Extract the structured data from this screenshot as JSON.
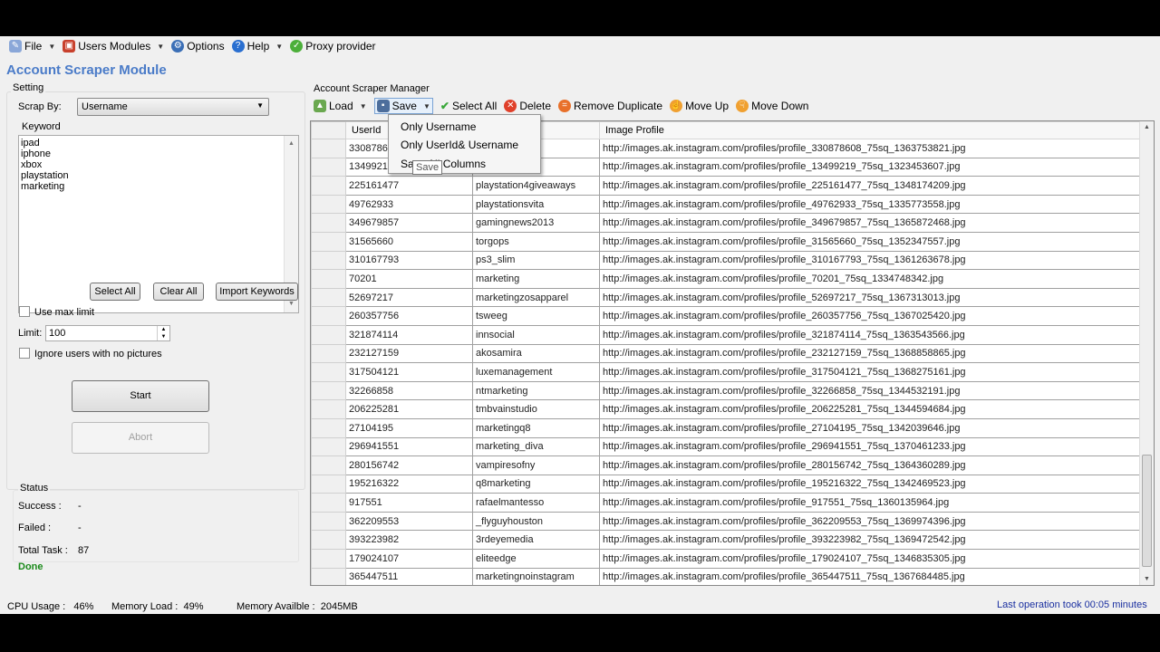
{
  "menu": [
    {
      "label": "File",
      "icon": "file-icon",
      "dropdown": true
    },
    {
      "label": "Users Modules",
      "icon": "users-modules-icon",
      "dropdown": true
    },
    {
      "label": "Options",
      "icon": "options-icon",
      "dropdown": false
    },
    {
      "label": "Help",
      "icon": "help-icon",
      "dropdown": true
    },
    {
      "label": "Proxy provider",
      "icon": "proxy-check-icon",
      "dropdown": false
    }
  ],
  "title": "Account Scraper Module",
  "setting": {
    "group": "Setting",
    "scrap_by_label": "Scrap By:",
    "scrap_by_value": "Username",
    "keyword_label": "Keyword",
    "keywords": [
      "ipad",
      "iphone",
      "xbox",
      "playstation",
      "marketing"
    ],
    "select_all": "Select All",
    "clear_all": "Clear All",
    "import_keywords": "Import Keywords",
    "use_max_limit": "Use max limit",
    "use_max_limit_checked": false,
    "limit_label": "Limit:",
    "limit_value": "100",
    "ignore_label": "Ignore users with no pictures",
    "ignore_checked": false,
    "start": "Start",
    "abort": "Abort"
  },
  "status": {
    "group": "Status",
    "success_label": "Success :",
    "success_value": "-",
    "failed_label": "Failed :",
    "failed_value": "-",
    "total_label": "Total Task :",
    "total_value": "87",
    "state": "Done",
    "state_color": "#1a8a1a"
  },
  "manager": {
    "group": "Account Scraper Manager",
    "toolbar": {
      "load": "Load",
      "save": "Save",
      "select_all": "Select All",
      "delete": "Delete",
      "remove_duplicate": "Remove Duplicate",
      "move_up": "Move Up",
      "move_down": "Move Down"
    },
    "save_menu": [
      "Only Username",
      "Only UserId& Username",
      "Save All Columns"
    ],
    "tooltip": "Save",
    "columns": [
      "UserId",
      "Username",
      "Image Profile"
    ],
    "rows": [
      [
        "330878608",
        "",
        "http://images.ak.instagram.com/profiles/profile_330878608_75sq_1363753821.jpg"
      ],
      [
        "13499219",
        "",
        "http://images.ak.instagram.com/profiles/profile_13499219_75sq_1323453607.jpg"
      ],
      [
        "225161477",
        "playstation4giveaways",
        "http://images.ak.instagram.com/profiles/profile_225161477_75sq_1348174209.jpg"
      ],
      [
        "49762933",
        "playstationsvita",
        "http://images.ak.instagram.com/profiles/profile_49762933_75sq_1335773558.jpg"
      ],
      [
        "349679857",
        "gamingnews2013",
        "http://images.ak.instagram.com/profiles/profile_349679857_75sq_1365872468.jpg"
      ],
      [
        "31565660",
        "torgops",
        "http://images.ak.instagram.com/profiles/profile_31565660_75sq_1352347557.jpg"
      ],
      [
        "310167793",
        "ps3_slim",
        "http://images.ak.instagram.com/profiles/profile_310167793_75sq_1361263678.jpg"
      ],
      [
        "70201",
        "marketing",
        "http://images.ak.instagram.com/profiles/profile_70201_75sq_1334748342.jpg"
      ],
      [
        "52697217",
        "marketingzosapparel",
        "http://images.ak.instagram.com/profiles/profile_52697217_75sq_1367313013.jpg"
      ],
      [
        "260357756",
        "tsweeg",
        "http://images.ak.instagram.com/profiles/profile_260357756_75sq_1367025420.jpg"
      ],
      [
        "321874114",
        "innsocial",
        "http://images.ak.instagram.com/profiles/profile_321874114_75sq_1363543566.jpg"
      ],
      [
        "232127159",
        "akosamira",
        "http://images.ak.instagram.com/profiles/profile_232127159_75sq_1368858865.jpg"
      ],
      [
        "317504121",
        "luxemanagement",
        "http://images.ak.instagram.com/profiles/profile_317504121_75sq_1368275161.jpg"
      ],
      [
        "32266858",
        "ntmarketing",
        "http://images.ak.instagram.com/profiles/profile_32266858_75sq_1344532191.jpg"
      ],
      [
        "206225281",
        "tmbvainstudio",
        "http://images.ak.instagram.com/profiles/profile_206225281_75sq_1344594684.jpg"
      ],
      [
        "27104195",
        "marketingq8",
        "http://images.ak.instagram.com/profiles/profile_27104195_75sq_1342039646.jpg"
      ],
      [
        "296941551",
        "marketing_diva",
        "http://images.ak.instagram.com/profiles/profile_296941551_75sq_1370461233.jpg"
      ],
      [
        "280156742",
        "vampiresofny",
        "http://images.ak.instagram.com/profiles/profile_280156742_75sq_1364360289.jpg"
      ],
      [
        "195216322",
        "q8marketing",
        "http://images.ak.instagram.com/profiles/profile_195216322_75sq_1342469523.jpg"
      ],
      [
        "917551",
        "rafaelmantesso",
        "http://images.ak.instagram.com/profiles/profile_917551_75sq_1360135964.jpg"
      ],
      [
        "362209553",
        "_flyguyhouston",
        "http://images.ak.instagram.com/profiles/profile_362209553_75sq_1369974396.jpg"
      ],
      [
        "393223982",
        "3rdeyemedia",
        "http://images.ak.instagram.com/profiles/profile_393223982_75sq_1369472542.jpg"
      ],
      [
        "179024107",
        "eliteedge",
        "http://images.ak.instagram.com/profiles/profile_179024107_75sq_1346835305.jpg"
      ],
      [
        "365447511",
        "marketingnoinstagram",
        "http://images.ak.instagram.com/profiles/profile_365447511_75sq_1367684485.jpg"
      ]
    ]
  },
  "statusbar": {
    "cpu_label": "CPU Usage :",
    "cpu_value": "46%",
    "mem_label": "Memory Load :",
    "mem_value": "49%",
    "avail_label": "Memory Availble :",
    "avail_value": "2045MB",
    "last_op": "Last operation took 00:05 minutes",
    "last_op_color": "#1a2fa0"
  }
}
